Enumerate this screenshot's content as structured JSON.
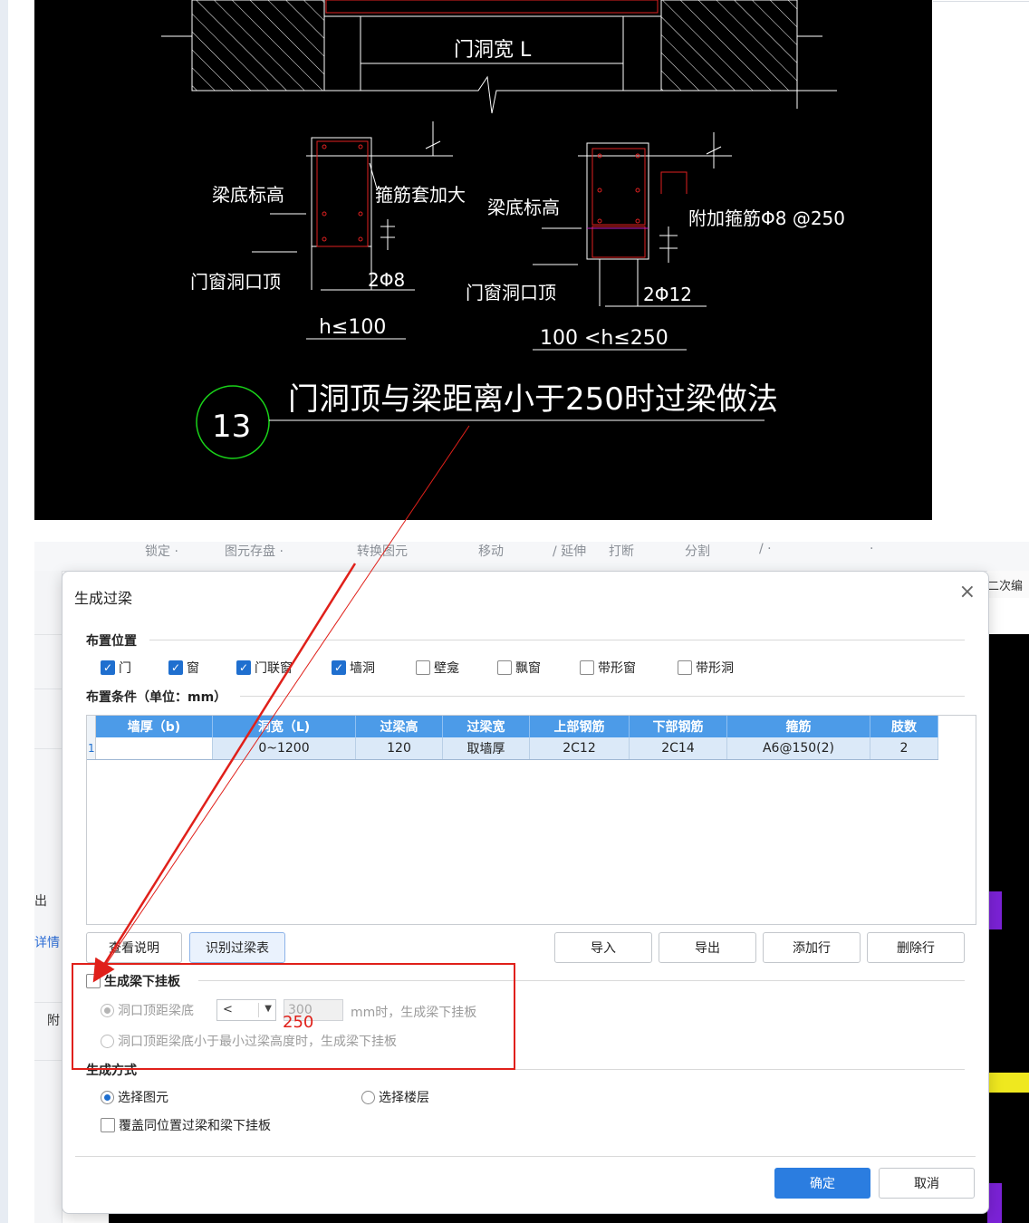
{
  "cad": {
    "top_label": "门洞宽 L",
    "left_detail": {
      "beam_bottom_label": "梁底标高",
      "stirrup_label": "箍筋套加大",
      "opening_top_label": "门窗洞口顶",
      "rebar_label": "2Φ8",
      "condition_label": "h≤100"
    },
    "right_detail": {
      "beam_bottom_label": "梁底标高",
      "extra_stirrup_label": "附加箍筋Φ8 @250",
      "opening_top_label": "门窗洞口顶",
      "rebar_label": "2Φ12",
      "condition_label": "100 <h≤250"
    },
    "detail_number": "13",
    "caption": "门洞顶与梁距离小于250时过梁做法"
  },
  "background_app": {
    "toolbar_items": [
      "锁定 ·",
      "图元存盘 ·",
      "转换图元",
      "移动",
      "/ 延伸",
      "打断",
      "分割",
      "/ ·",
      "·"
    ],
    "right_tab": "二次编",
    "left_texts": [
      "出",
      "详情",
      "附"
    ]
  },
  "dialog": {
    "title": "生成过梁",
    "close_glyph": "×",
    "placement": {
      "title": "布置位置",
      "options": [
        {
          "label": "门",
          "checked": true
        },
        {
          "label": "窗",
          "checked": true
        },
        {
          "label": "门联窗",
          "checked": true
        },
        {
          "label": "墙洞",
          "checked": true
        },
        {
          "label": "壁龛",
          "checked": false
        },
        {
          "label": "飘窗",
          "checked": false
        },
        {
          "label": "带形窗",
          "checked": false
        },
        {
          "label": "带形洞",
          "checked": false
        }
      ]
    },
    "conditions": {
      "title": "布置条件（单位：mm）",
      "columns": [
        "墙厚（b)",
        "洞宽（L)",
        "过梁高",
        "过梁宽",
        "上部钢筋",
        "下部钢筋",
        "箍筋",
        "肢数"
      ],
      "rows": [
        {
          "num": "1",
          "cells": [
            "",
            "0~1200",
            "120",
            "取墙厚",
            "2C12",
            "2C14",
            "A6@150(2)",
            "2"
          ]
        }
      ]
    },
    "buttons": {
      "view_help": "查看说明",
      "recognize_table": "识别过梁表",
      "import": "导入",
      "export": "导出",
      "add_row": "添加行",
      "delete_row": "删除行"
    },
    "hanging_plate": {
      "title": "生成梁下挂板",
      "checked": false,
      "option1_label": "洞口顶距梁底",
      "option1_operator": "<",
      "option1_value": "300",
      "option1_suffix": "mm时，生成梁下挂板",
      "option2_label": "洞口顶距梁底小于最小过梁高度时，生成梁下挂板"
    },
    "generate_method": {
      "title": "生成方式",
      "option_select_elements": "选择图元",
      "option_select_floors": "选择楼层",
      "selected": "选择图元",
      "overwrite_label": "覆盖同位置过梁和梁下挂板",
      "overwrite_checked": false
    },
    "ok_label": "确定",
    "cancel_label": "取消"
  },
  "annotation": {
    "value": "250",
    "color": "#e0201a"
  },
  "colors": {
    "accent": "#2b7de0",
    "table_header": "#4c9be8",
    "selected_row": "#dbe9f8",
    "cad_green": "#19d219",
    "cad_red": "#e02020"
  }
}
